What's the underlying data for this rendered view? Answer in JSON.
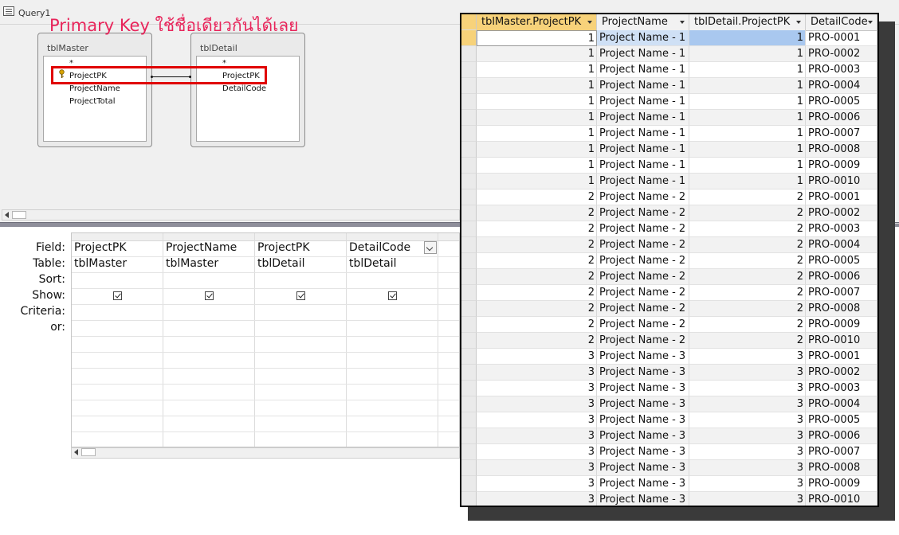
{
  "query_tab": {
    "title": "Query1"
  },
  "annotation": "Primary Key ใช้ชื่อเดียวกันได้เลย",
  "tables": {
    "master": {
      "name": "tblMaster",
      "fields": [
        "*",
        "ProjectPK",
        "ProjectName",
        "ProjectTotal"
      ]
    },
    "detail": {
      "name": "tblDetail",
      "fields": [
        "*",
        "ProjectPK",
        "DetailCode"
      ]
    }
  },
  "grid": {
    "row_labels": [
      "Field:",
      "Table:",
      "Sort:",
      "Show:",
      "Criteria:",
      "or:"
    ],
    "columns": [
      {
        "field": "ProjectPK",
        "table": "tblMaster",
        "show": true
      },
      {
        "field": "ProjectName",
        "table": "tblMaster",
        "show": true
      },
      {
        "field": "ProjectPK",
        "table": "tblDetail",
        "show": true
      },
      {
        "field": "DetailCode",
        "table": "tblDetail",
        "show": true
      }
    ]
  },
  "results": {
    "headers": [
      "tblMaster.ProjectPK",
      "ProjectName",
      "tblDetail.ProjectPK",
      "DetailCode"
    ],
    "rows": [
      [
        1,
        "Project Name - 1",
        1,
        "PRO-0001"
      ],
      [
        1,
        "Project Name - 1",
        1,
        "PRO-0002"
      ],
      [
        1,
        "Project Name - 1",
        1,
        "PRO-0003"
      ],
      [
        1,
        "Project Name - 1",
        1,
        "PRO-0004"
      ],
      [
        1,
        "Project Name - 1",
        1,
        "PRO-0005"
      ],
      [
        1,
        "Project Name - 1",
        1,
        "PRO-0006"
      ],
      [
        1,
        "Project Name - 1",
        1,
        "PRO-0007"
      ],
      [
        1,
        "Project Name - 1",
        1,
        "PRO-0008"
      ],
      [
        1,
        "Project Name - 1",
        1,
        "PRO-0009"
      ],
      [
        1,
        "Project Name - 1",
        1,
        "PRO-0010"
      ],
      [
        2,
        "Project Name - 2",
        2,
        "PRO-0001"
      ],
      [
        2,
        "Project Name - 2",
        2,
        "PRO-0002"
      ],
      [
        2,
        "Project Name - 2",
        2,
        "PRO-0003"
      ],
      [
        2,
        "Project Name - 2",
        2,
        "PRO-0004"
      ],
      [
        2,
        "Project Name - 2",
        2,
        "PRO-0005"
      ],
      [
        2,
        "Project Name - 2",
        2,
        "PRO-0006"
      ],
      [
        2,
        "Project Name - 2",
        2,
        "PRO-0007"
      ],
      [
        2,
        "Project Name - 2",
        2,
        "PRO-0008"
      ],
      [
        2,
        "Project Name - 2",
        2,
        "PRO-0009"
      ],
      [
        2,
        "Project Name - 2",
        2,
        "PRO-0010"
      ],
      [
        3,
        "Project Name - 3",
        3,
        "PRO-0001"
      ],
      [
        3,
        "Project Name - 3",
        3,
        "PRO-0002"
      ],
      [
        3,
        "Project Name - 3",
        3,
        "PRO-0003"
      ],
      [
        3,
        "Project Name - 3",
        3,
        "PRO-0004"
      ],
      [
        3,
        "Project Name - 3",
        3,
        "PRO-0005"
      ],
      [
        3,
        "Project Name - 3",
        3,
        "PRO-0006"
      ],
      [
        3,
        "Project Name - 3",
        3,
        "PRO-0007"
      ],
      [
        3,
        "Project Name - 3",
        3,
        "PRO-0008"
      ],
      [
        3,
        "Project Name - 3",
        3,
        "PRO-0009"
      ],
      [
        3,
        "Project Name - 3",
        3,
        "PRO-0010"
      ]
    ]
  },
  "colors": {
    "annotation": "#e8245a",
    "highlight_box": "#e00000",
    "selected_row": "#a9c8ef",
    "header_active": "#f7d27a"
  }
}
